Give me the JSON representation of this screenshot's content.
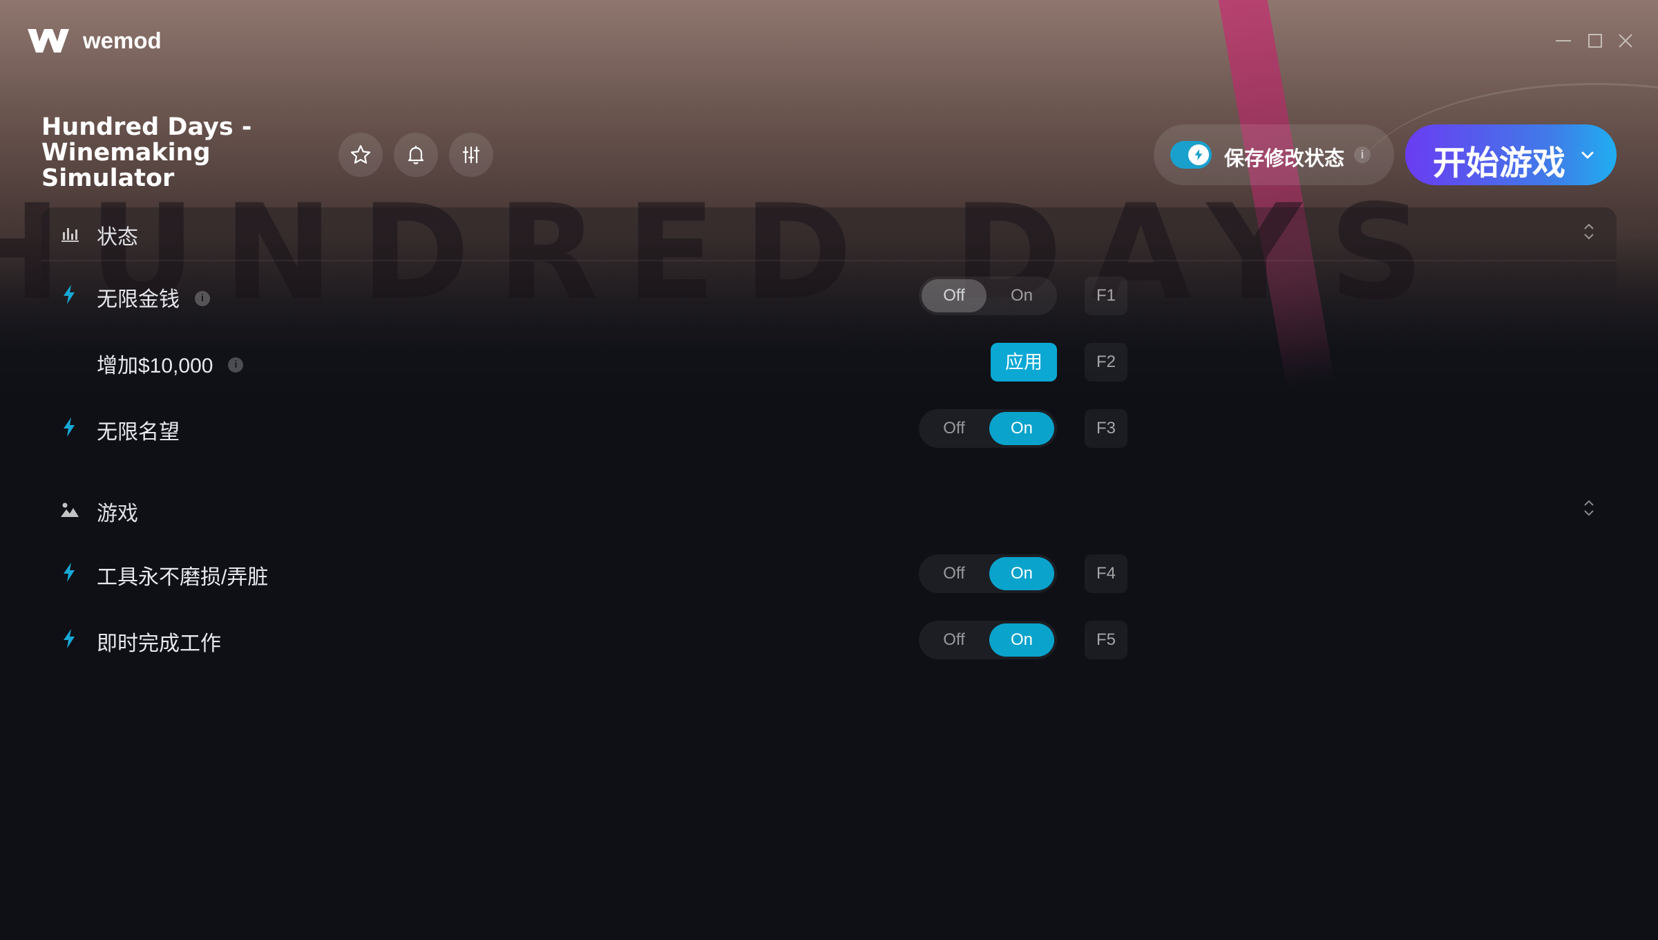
{
  "app": {
    "name": "wemod"
  },
  "game": {
    "title": "Hundred Days - Winemaking Simulator",
    "banner_text": "HUNDRED DAYS"
  },
  "header_buttons": [
    {
      "name": "favorite",
      "icon": "star-icon"
    },
    {
      "name": "notifications",
      "icon": "bell-icon"
    },
    {
      "name": "settings",
      "icon": "sliders-icon"
    }
  ],
  "save_mods": {
    "label": "保存修改状态",
    "enabled": true,
    "info": "i"
  },
  "play_button": {
    "label": "开始游戏"
  },
  "sections": [
    {
      "title": "状态",
      "icon": "bar-chart-icon",
      "mods": [
        {
          "label": "无限金钱",
          "type": "toggle",
          "state": "Off",
          "hotkey": "F1",
          "info": "i"
        },
        {
          "label": "增加$10,000",
          "type": "apply",
          "button_label": "应用",
          "hotkey": "F2",
          "info": "i"
        },
        {
          "label": "无限名望",
          "type": "toggle",
          "state": "On",
          "hotkey": "F3"
        }
      ]
    },
    {
      "title": "游戏",
      "icon": "landscape-icon",
      "mods": [
        {
          "label": "工具永不磨损/弄脏",
          "type": "toggle",
          "state": "On",
          "hotkey": "F4"
        },
        {
          "label": "即时完成工作",
          "type": "toggle",
          "state": "On",
          "hotkey": "F5"
        }
      ]
    }
  ],
  "toggle_labels": {
    "off": "Off",
    "on": "On"
  },
  "colors": {
    "accent": "#0aa3cc",
    "play_gradient_start": "#6a3cf2",
    "play_gradient_end": "#20aef0",
    "background": "#0e1016"
  }
}
